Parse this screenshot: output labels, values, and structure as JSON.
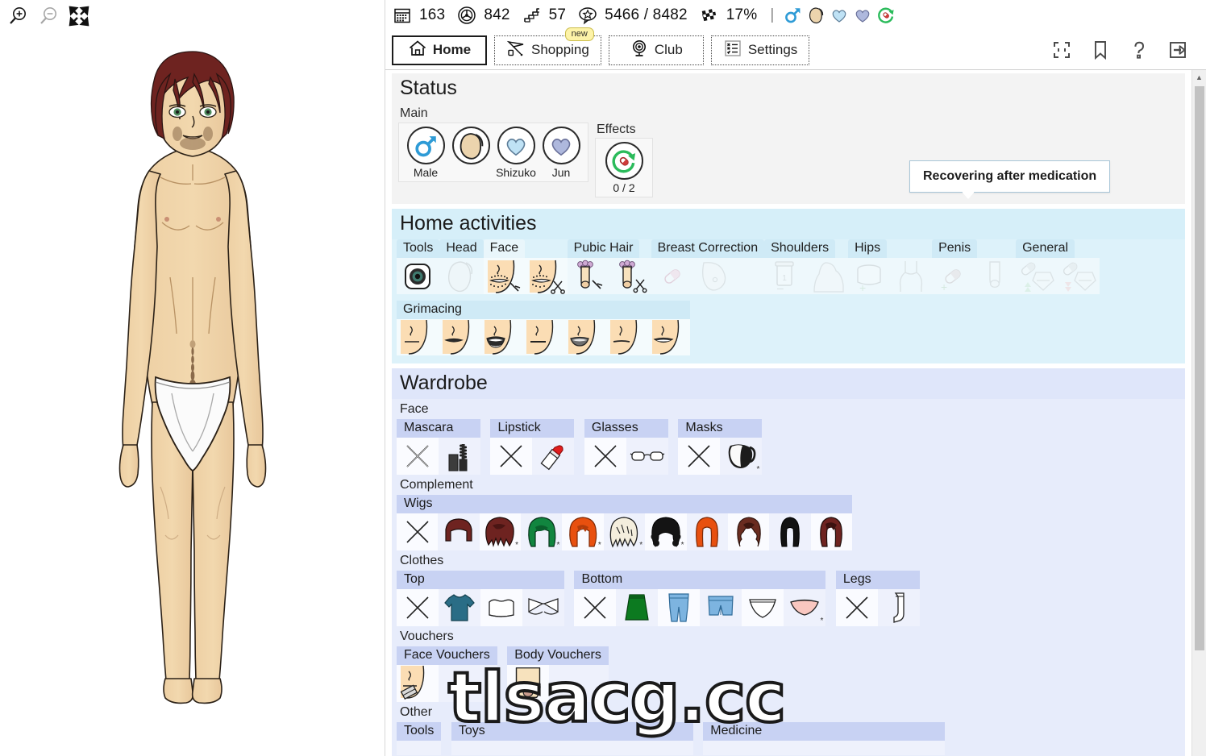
{
  "left_toolbar": {
    "zoom_in": "zoom-in-icon",
    "zoom_out": "zoom-out-icon",
    "fullscreen": "expand-arrows-icon"
  },
  "statbar": {
    "items": [
      {
        "icon": "calendar-icon",
        "value": "163"
      },
      {
        "icon": "biohazard-icon",
        "value": "842"
      },
      {
        "icon": "stairs-icon",
        "value": "57"
      },
      {
        "icon": "star-speech-bubble-icon",
        "value": "5466 / 8482"
      },
      {
        "icon": "checkered-flag-icon",
        "value": "17%"
      }
    ],
    "separator": "|",
    "chips": [
      {
        "icon": "mars-symbol-icon",
        "label": "male"
      },
      {
        "icon": "face-profile-icon",
        "label": "face"
      },
      {
        "icon": "heart-light-blue-icon",
        "label": "shizuko"
      },
      {
        "icon": "heart-periwinkle-icon",
        "label": "jun"
      },
      {
        "icon": "pill-recovery-icon",
        "label": "medication"
      }
    ]
  },
  "nav": {
    "tabs": [
      {
        "label": "Home",
        "icon": "home-icon",
        "active": true,
        "badge": ""
      },
      {
        "label": "Shopping",
        "icon": "shopping-cart-icon",
        "active": false,
        "badge": "new"
      },
      {
        "label": "Club",
        "icon": "webcam-icon",
        "active": false,
        "badge": ""
      },
      {
        "label": "Settings",
        "icon": "checklist-icon",
        "active": false,
        "badge": ""
      }
    ],
    "right_icons": [
      {
        "icon": "fullscreen-frame-icon"
      },
      {
        "icon": "bookmark-icon"
      },
      {
        "icon": "help-question-icon"
      },
      {
        "icon": "exit-arrow-icon"
      }
    ]
  },
  "tooltip": {
    "text": "Recovering after medication"
  },
  "status": {
    "title": "Status",
    "main_label": "Main",
    "effects_label": "Effects",
    "main_cards": [
      {
        "caption": "Male",
        "icon": "mars-symbol-icon"
      },
      {
        "caption": "",
        "icon": "face-profile-icon"
      },
      {
        "caption": "Shizuko",
        "icon": "heart-light-blue-icon"
      },
      {
        "caption": "Jun",
        "icon": "heart-periwinkle-icon"
      }
    ],
    "effect_cards": [
      {
        "caption": "0 / 2",
        "icon": "pill-recovery-icon"
      }
    ]
  },
  "home_activities": {
    "title": "Home activities",
    "groups": [
      {
        "name": "Tools",
        "selected": false,
        "disabled": false,
        "items": [
          {
            "icon": "camera-lens-icon"
          }
        ]
      },
      {
        "name": "Head",
        "selected": false,
        "disabled": false,
        "items": [
          {
            "icon": "head-shave-icon"
          }
        ]
      },
      {
        "name": "Face",
        "selected": true,
        "disabled": false,
        "items": [
          {
            "icon": "beard-razor-icon"
          },
          {
            "icon": "beard-scissors-icon"
          }
        ]
      },
      {
        "name": "Pubic Hair",
        "selected": false,
        "disabled": false,
        "items": [
          {
            "icon": "pubic-razor-icon"
          },
          {
            "icon": "pubic-scissors-icon"
          }
        ]
      },
      {
        "name": "Breast Correction",
        "selected": false,
        "disabled": true,
        "items": [
          {
            "icon": "pill-breast-icon"
          },
          {
            "icon": "breast-shape-icon"
          }
        ]
      },
      {
        "name": "Shoulders",
        "selected": false,
        "disabled": true,
        "items": [
          {
            "icon": "jar-shoulder-icon"
          },
          {
            "icon": "shoulder-shape-icon"
          }
        ]
      },
      {
        "name": "Hips",
        "selected": false,
        "disabled": true,
        "items": [
          {
            "icon": "jar-hips-icon"
          },
          {
            "icon": "hips-shape-icon"
          }
        ]
      },
      {
        "name": "Penis",
        "selected": false,
        "disabled": true,
        "items": [
          {
            "icon": "pill-penis-icon"
          },
          {
            "icon": "penis-shape-icon"
          }
        ]
      },
      {
        "name": "General",
        "selected": false,
        "disabled": true,
        "items": [
          {
            "icon": "pill-general-up-icon"
          },
          {
            "icon": "pill-general-down-icon"
          }
        ]
      }
    ],
    "grimacing": {
      "name": "Grimacing",
      "items": [
        {
          "icon": "mouth-neutral-icon"
        },
        {
          "icon": "mouth-closed-dark-icon"
        },
        {
          "icon": "mouth-open-icon"
        },
        {
          "icon": "mouth-thin-line-icon"
        },
        {
          "icon": "mouth-grimace-icon"
        },
        {
          "icon": "mouth-flat-icon"
        },
        {
          "icon": "mouth-slight-open-icon"
        }
      ]
    }
  },
  "wardrobe": {
    "title": "Wardrobe",
    "face_label": "Face",
    "complement_label": "Complement",
    "clothes_label": "Clothes",
    "vouchers_label": "Vouchers",
    "other_label": "Other",
    "face_groups": [
      {
        "name": "Mascara",
        "items": [
          {
            "icon": "none-x-icon"
          },
          {
            "icon": "mascara-icon"
          }
        ]
      },
      {
        "name": "Lipstick",
        "items": [
          {
            "icon": "none-x-icon"
          },
          {
            "icon": "lipstick-icon"
          }
        ]
      },
      {
        "name": "Glasses",
        "items": [
          {
            "icon": "none-x-icon"
          },
          {
            "icon": "glasses-icon"
          }
        ]
      },
      {
        "name": "Masks",
        "items": [
          {
            "icon": "none-x-icon"
          },
          {
            "icon": "face-mask-icon",
            "star": "*"
          }
        ]
      }
    ],
    "wigs": {
      "name": "Wigs",
      "items": [
        {
          "icon": "none-x-icon"
        },
        {
          "icon": "wig-short-maroon-icon"
        },
        {
          "icon": "wig-messy-maroon-icon",
          "star": "*"
        },
        {
          "icon": "wig-green-bob-icon",
          "star": "*"
        },
        {
          "icon": "wig-orange-bob-icon",
          "star": "*"
        },
        {
          "icon": "wig-spiky-blonde-icon",
          "star": "*"
        },
        {
          "icon": "wig-black-curly-icon",
          "star": "*"
        },
        {
          "icon": "wig-orange-long-icon"
        },
        {
          "icon": "wig-brown-wavy-icon"
        },
        {
          "icon": "wig-black-straight-icon"
        },
        {
          "icon": "wig-maroon-long-icon"
        }
      ]
    },
    "clothes_groups": [
      {
        "name": "Top",
        "items": [
          {
            "icon": "none-x-icon"
          },
          {
            "icon": "tshirt-teal-icon"
          },
          {
            "icon": "crop-top-white-icon"
          },
          {
            "icon": "bra-white-icon"
          }
        ]
      },
      {
        "name": "Bottom",
        "items": [
          {
            "icon": "none-x-icon"
          },
          {
            "icon": "skirt-green-icon"
          },
          {
            "icon": "jeans-blue-icon"
          },
          {
            "icon": "shorts-blue-icon"
          },
          {
            "icon": "panties-white-icon"
          },
          {
            "icon": "panties-pink-icon",
            "star": "*"
          }
        ]
      },
      {
        "name": "Legs",
        "items": [
          {
            "icon": "none-x-icon"
          },
          {
            "icon": "stocking-white-icon"
          }
        ]
      }
    ],
    "voucher_groups": [
      {
        "name": "Face Vouchers",
        "items": [
          {
            "icon": "face-voucher-icon"
          }
        ]
      },
      {
        "name": "Body Vouchers",
        "items": [
          {
            "icon": "body-voucher-icon"
          }
        ]
      }
    ],
    "other_groups": [
      {
        "name": "Tools",
        "items": []
      },
      {
        "name": "Toys",
        "items": []
      },
      {
        "name": "Medicine",
        "items": []
      }
    ]
  },
  "watermark": {
    "text": "tlsacg.cc"
  },
  "colors": {
    "home_bg": "#ddf2fa",
    "wardrobe_bg": "#e7ecfb",
    "status_bg": "#f3f3f3",
    "accent_blue": "#2e9bd6",
    "badge_yellow": "#fdf3a8"
  }
}
